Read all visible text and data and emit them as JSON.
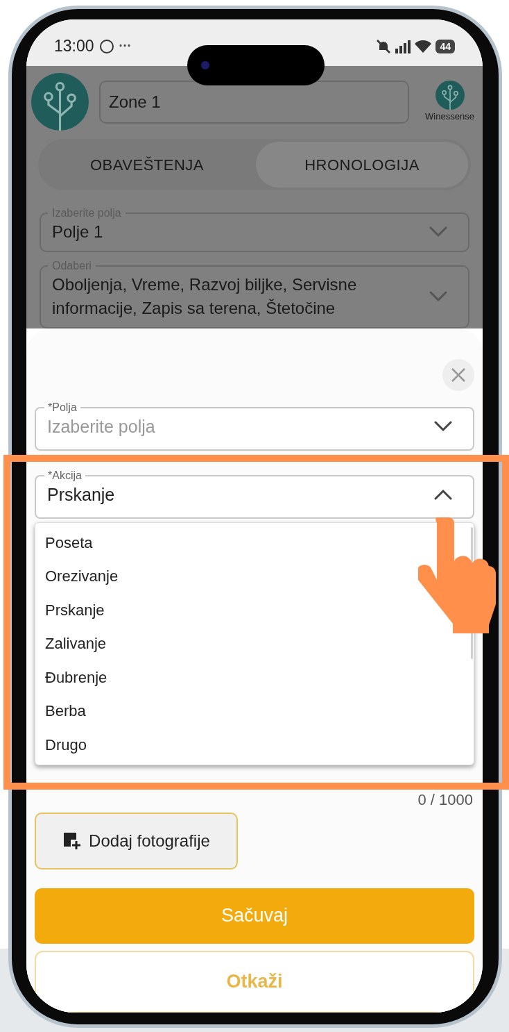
{
  "status_bar": {
    "time": "13:00",
    "more": "···",
    "battery": "44"
  },
  "header": {
    "zone": "Zone 1",
    "brand": "Winessense"
  },
  "tabs": [
    {
      "label": "OBAVEŠTENJA",
      "selected": false
    },
    {
      "label": "HRONOLOGIJA",
      "selected": true
    }
  ],
  "filters": [
    {
      "label": "Izaberite polja",
      "value": "Polje 1"
    },
    {
      "label": "Odaberi",
      "value": "Oboljenja, Vreme, Razvoj biljke, Servisne informacije, Zapis sa terena, Štetočine"
    }
  ],
  "sheet": {
    "fields": [
      {
        "label": "*Polja",
        "placeholder": "Izaberite polja",
        "expanded": false
      },
      {
        "label": "*Akcija",
        "value": "Prskanje",
        "expanded": true
      }
    ],
    "options": [
      "Poseta",
      "Orezivanje",
      "Prskanje",
      "Zalivanje",
      "Đubrenje",
      "Berba",
      "Drugo"
    ],
    "counter": "0 / 1000",
    "add_photo": "Dodaj fotografije",
    "save": "Sačuvaj",
    "cancel": "Otkaži"
  }
}
